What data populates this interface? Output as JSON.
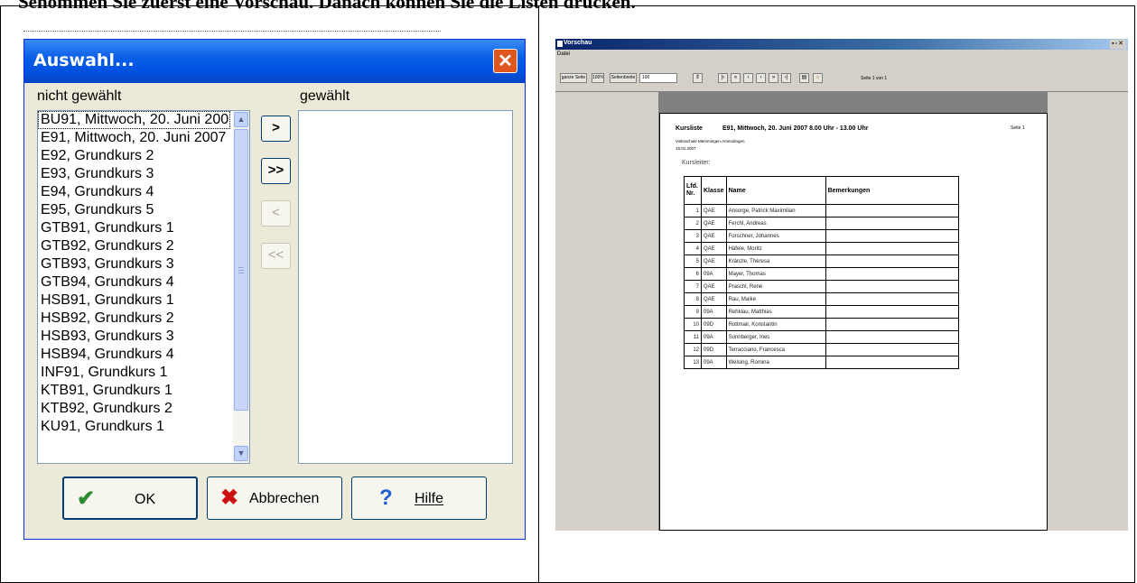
{
  "heading": "Sehommen Sie zuerst eine Vorschau. Danach können Sie die Listen drucken.",
  "dialog": {
    "title": "Auswahl...",
    "label_not_selected": "nicht gewählt",
    "label_selected": "gewählt",
    "available_items": [
      "BU91, Mittwoch, 20. Juni 200",
      "E91, Mittwoch, 20. Juni 2007",
      "E92, Grundkurs 2",
      "E93, Grundkurs 3",
      "E94, Grundkurs 4",
      "E95, Grundkurs 5",
      "GTB91, Grundkurs 1",
      "GTB92, Grundkurs 2",
      "GTB93, Grundkurs 3",
      "GTB94, Grundkurs 4",
      "HSB91, Grundkurs 1",
      "HSB92, Grundkurs 2",
      "HSB93, Grundkurs 3",
      "HSB94, Grundkurs 4",
      "INF91, Grundkurs 1",
      "KTB91, Grundkurs 1",
      "KTB92, Grundkurs 2",
      "KU91, Grundkurs 1"
    ],
    "move_right": ">",
    "move_all_right": ">>",
    "move_left": "<",
    "move_all_left": "<<",
    "ok_label": "OK",
    "cancel_label": "Abbrechen",
    "help_label": "Hilfe",
    "colors": {
      "title_bar": "#0A5FE6",
      "close": "#E0561F",
      "ok_check": "#2E8B2E",
      "cancel_x": "#CC1111",
      "help_q": "#1F5FD0"
    }
  },
  "preview": {
    "title": "Vorschau",
    "menu": "Datei",
    "toolbar": {
      "whole_page": "ganze Seite",
      "percent_100": "100%",
      "page_width": "Seitenbreite",
      "zoom": "100",
      "page_info": "Seite 1 von 1"
    },
    "report": {
      "title": "Kursliste",
      "course": "E91, Mittwoch, 20. Juni 2007 8.00 Uhr - 13.00 Uhr",
      "page": "Seite 1",
      "school": "Volksschule Memmingen-Amendingen",
      "date": "18.01.2007",
      "leader": "Kursleiter:",
      "headers": [
        "Lfd. Nr.",
        "Klasse",
        "Name",
        "Bemerkungen"
      ],
      "rows": [
        [
          "1",
          "QAE",
          "Ansorge, Patrick Maximilian",
          ""
        ],
        [
          "2",
          "QAE",
          "Ferchl, Andreas",
          ""
        ],
        [
          "3",
          "QAE",
          "Forschner, Johannes",
          ""
        ],
        [
          "4",
          "QAE",
          "Häfele, Moritz",
          ""
        ],
        [
          "5",
          "QAE",
          "Kränzle, Theresa",
          ""
        ],
        [
          "6",
          "09A",
          "Mayer, Thomas",
          ""
        ],
        [
          "7",
          "QAE",
          "Praschl, René",
          ""
        ],
        [
          "8",
          "QAE",
          "Rau, Maike",
          ""
        ],
        [
          "9",
          "09A",
          "Rehklau, Matthias",
          ""
        ],
        [
          "10",
          "09D",
          "Rottmair, Konstantin",
          ""
        ],
        [
          "11",
          "09A",
          "Sonnberger, Ines",
          ""
        ],
        [
          "12",
          "09D",
          "Terracciano, Francesca",
          ""
        ],
        [
          "13",
          "09A",
          "Welsing, Romina",
          ""
        ]
      ]
    }
  }
}
